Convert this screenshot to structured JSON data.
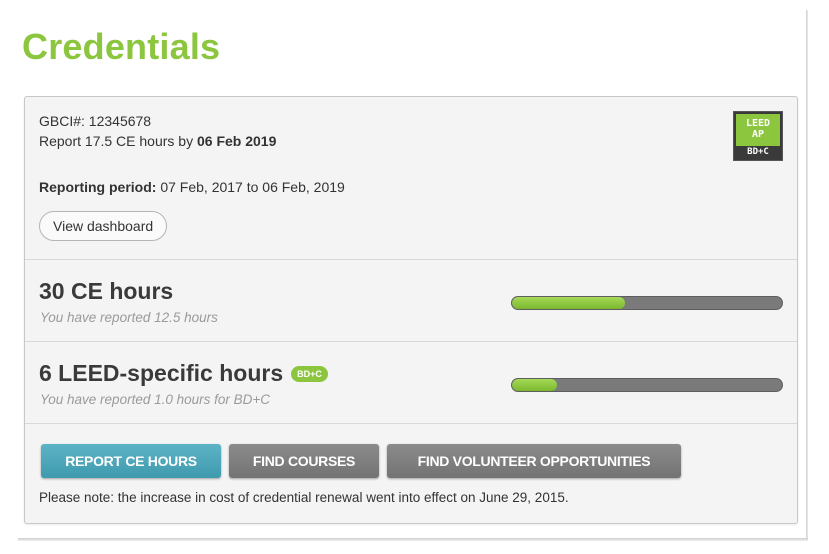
{
  "page": {
    "title": "Credentials"
  },
  "credential": {
    "gbci_label": "GBCI#:",
    "gbci_number": "12345678",
    "report_prefix": "Report 17.5 CE hours by",
    "report_deadline": "06 Feb 2019",
    "period_label": "Reporting period:",
    "period_value": "07 Feb, 2017 to 06 Feb, 2019",
    "dashboard_button": "View dashboard",
    "badge": {
      "line1": "LEED",
      "line2": "AP",
      "line3": "BD+C",
      "color": "#8cc63f"
    }
  },
  "ce_hours": {
    "title": "30 CE hours",
    "subtitle": "You have reported 12.5 hours",
    "progress_fraction": 0.4167
  },
  "leed_hours": {
    "title": "6 LEED-specific hours",
    "tag": "BD+C",
    "subtitle": "You have reported 1.0 hours for BD+C",
    "progress_fraction": 0.1667
  },
  "actions": {
    "report_button": "REPORT CE HOURS",
    "courses_button": "FIND COURSES",
    "volunteer_button": "FIND VOLUNTEER OPPORTUNITIES",
    "note": "Please note: the increase in cost of credential renewal went into effect on June 29, 2015."
  },
  "colors": {
    "accent_green": "#8cc63f",
    "primary_button": "#4aa5b9",
    "secondary_button": "#7f7f7f"
  }
}
